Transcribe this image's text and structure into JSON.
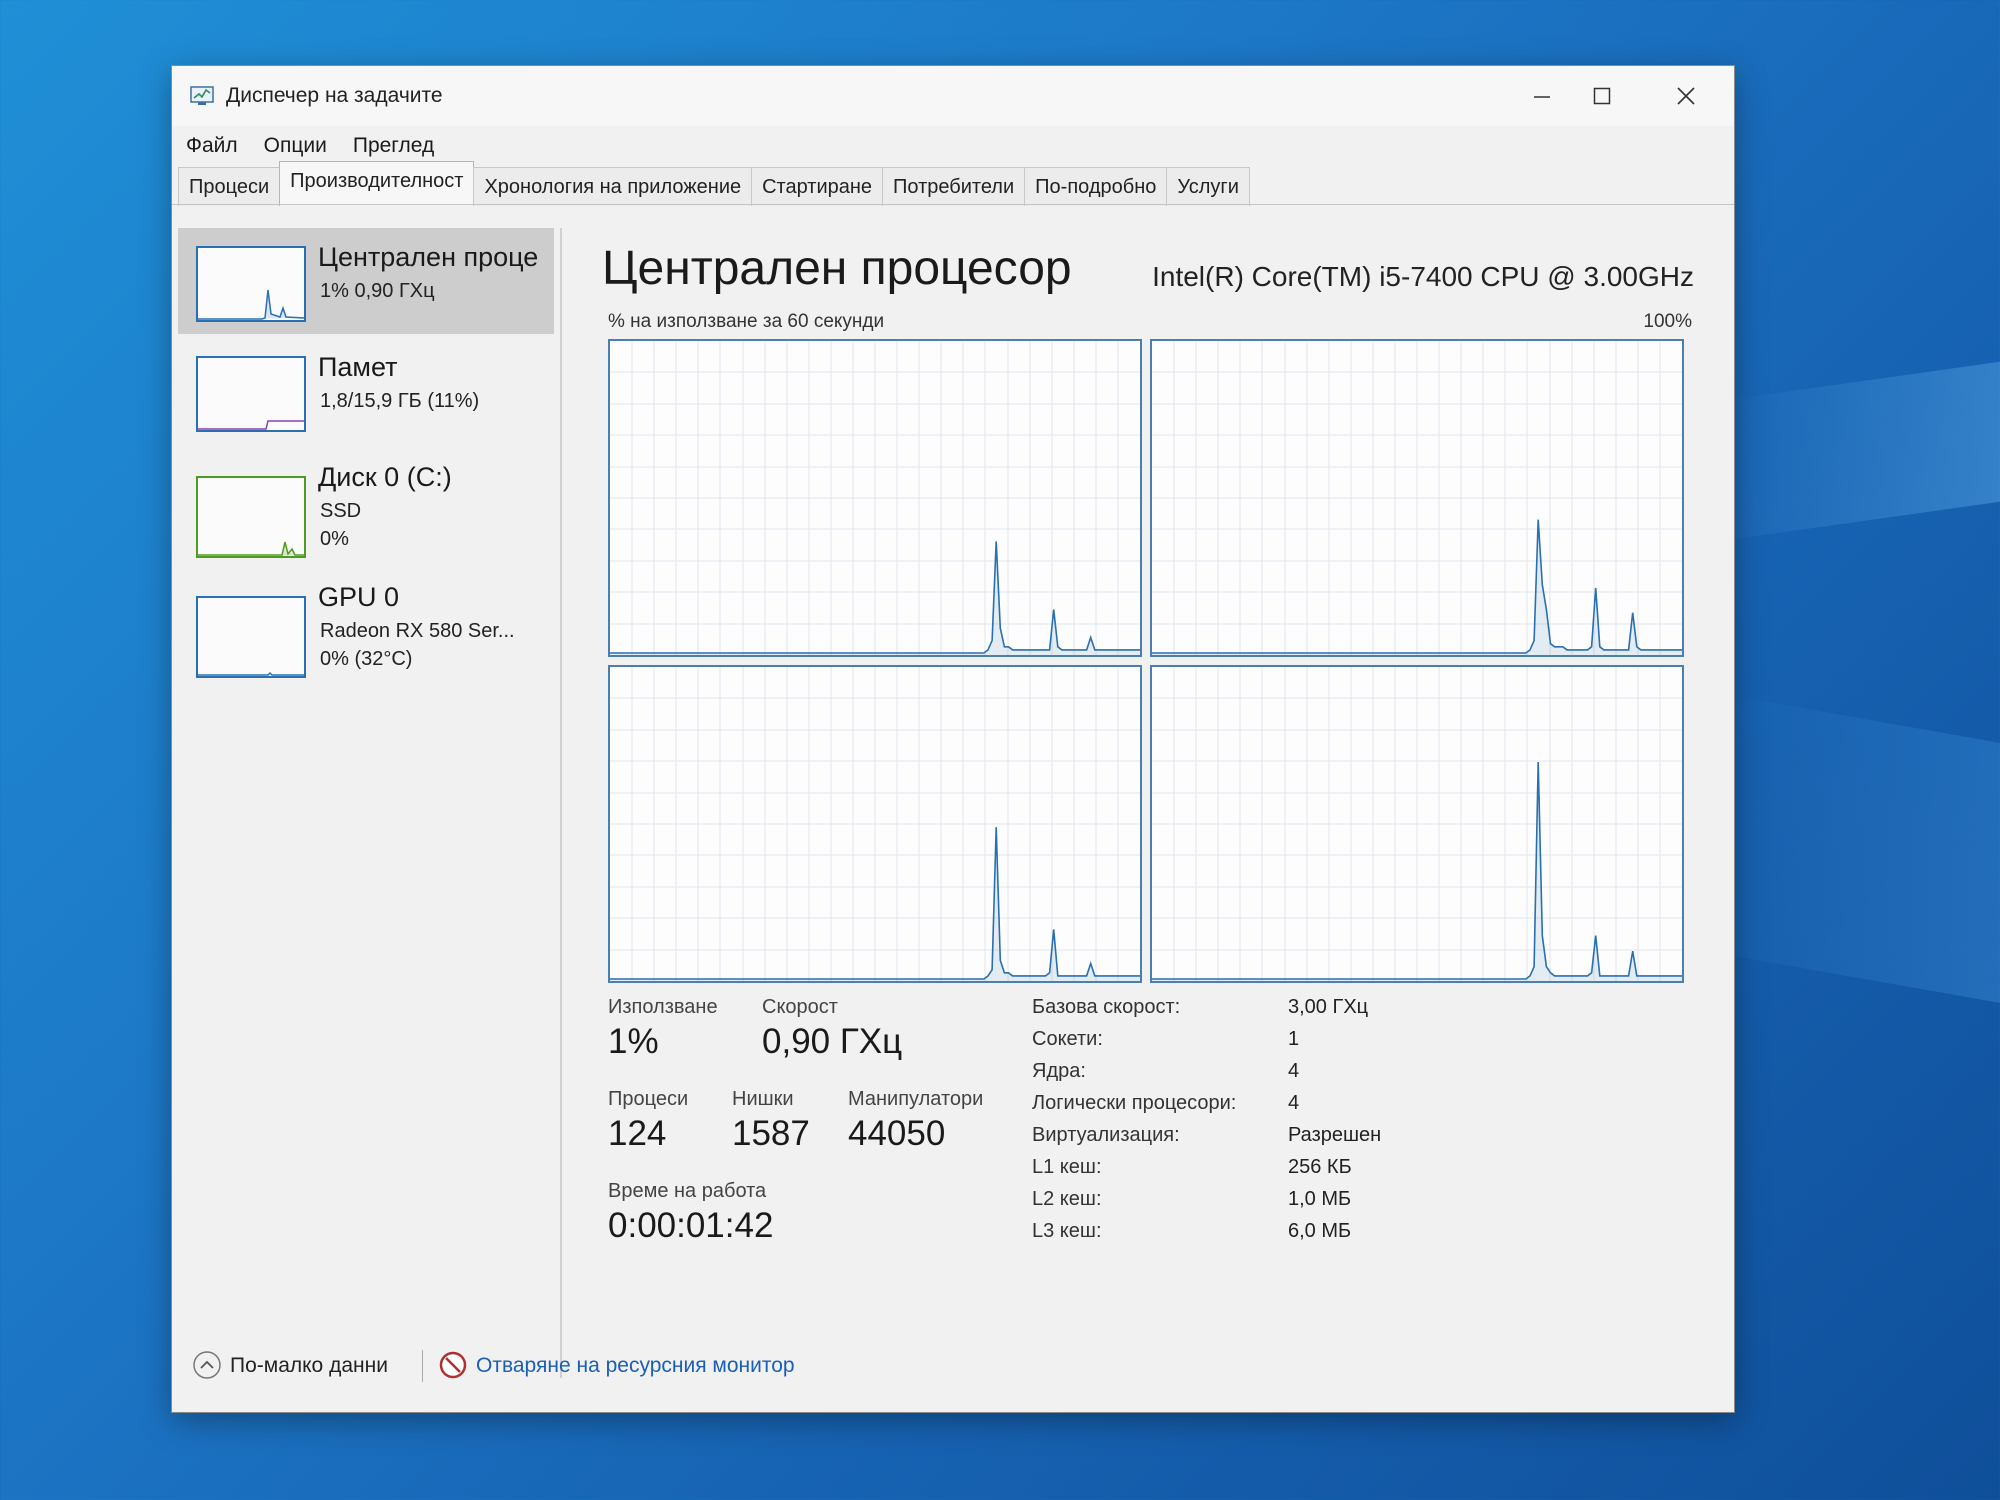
{
  "window": {
    "title": "Диспечер на задачите"
  },
  "menu": [
    "Файл",
    "Опции",
    "Преглед"
  ],
  "tabs": [
    "Процеси",
    "Производителност",
    "Хронология на приложение",
    "Стартиране",
    "Потребители",
    "По-подробно",
    "Услуги"
  ],
  "active_tab": "Производителност",
  "sidebar": {
    "cpu": {
      "name": "Централен проце",
      "line1": "1%  0,90 ГХц"
    },
    "memory": {
      "name": "Памет",
      "line1": "1,8/15,9 ГБ (11%)"
    },
    "disk": {
      "name": "Диск 0 (C:)",
      "line1": "SSD",
      "line2": "0%"
    },
    "gpu": {
      "name": "GPU 0",
      "line1": "Radeon RX 580 Ser...",
      "line2": "0%  (32°C)"
    }
  },
  "main": {
    "title": "Централен процесор",
    "model": "Intel(R) Core(TM) i5-7400 CPU @ 3.00GHz",
    "graph_label": "% на използване за 60 секунди",
    "graph_max": "100%"
  },
  "stats": {
    "usage_label": "Използване",
    "usage": "1%",
    "speed_label": "Скорост",
    "speed": "0,90 ГХц",
    "procs_label": "Процеси",
    "procs": "124",
    "threads_label": "Нишки",
    "threads": "1587",
    "handles_label": "Манипулатори",
    "handles": "44050",
    "uptime_label": "Време на работа",
    "uptime": "0:00:01:42"
  },
  "specs": [
    {
      "label": "Базова скорост:",
      "value": "3,00 ГХц"
    },
    {
      "label": "Сокети:",
      "value": "1"
    },
    {
      "label": "Ядра:",
      "value": "4"
    },
    {
      "label": "Логически процесори:",
      "value": "4"
    },
    {
      "label": "Виртуализация:",
      "value": "Разрешен"
    },
    {
      "label": "L1 кеш:",
      "value": "256 КБ"
    },
    {
      "label": "L2 кеш:",
      "value": "1,0 МБ"
    },
    {
      "label": "L3 кеш:",
      "value": "6,0 МБ"
    }
  ],
  "footer": {
    "less": "По-малко данни",
    "link": "Отваряне на ресурсния монитор"
  },
  "colors": {
    "cpu_line": "#2a6fb0",
    "disk_line": "#4f9a20",
    "link": "#1a5fb4"
  },
  "cpu_graphs": [
    [
      0,
      0,
      0,
      0,
      0,
      0,
      0,
      0,
      0,
      0,
      0,
      0,
      0,
      0,
      0,
      0,
      0,
      0,
      0,
      0,
      0,
      0,
      0,
      0,
      0,
      0,
      0,
      0,
      0,
      0,
      0,
      0,
      0,
      0,
      0,
      0,
      0,
      0,
      0,
      0,
      0,
      0,
      0,
      0,
      0,
      0,
      0,
      0,
      0,
      0,
      0,
      0,
      0,
      0,
      0,
      0,
      0,
      0,
      0,
      0,
      0,
      0,
      0,
      0,
      0,
      0,
      0,
      0,
      0,
      0,
      0,
      0,
      0,
      0,
      0,
      0,
      0,
      0,
      0,
      0,
      0,
      0,
      0,
      0,
      0,
      0,
      0,
      0,
      0,
      0,
      0,
      0,
      1,
      4,
      36,
      8,
      2,
      2,
      1,
      1,
      1,
      1,
      1,
      1,
      1,
      1,
      1,
      1,
      14,
      2,
      1,
      1,
      1,
      1,
      1,
      1,
      1,
      5,
      1,
      1,
      1,
      1,
      1,
      1,
      1,
      1,
      1,
      1,
      1,
      1
    ],
    [
      0,
      0,
      0,
      0,
      0,
      0,
      0,
      0,
      0,
      0,
      0,
      0,
      0,
      0,
      0,
      0,
      0,
      0,
      0,
      0,
      0,
      0,
      0,
      0,
      0,
      0,
      0,
      0,
      0,
      0,
      0,
      0,
      0,
      0,
      0,
      0,
      0,
      0,
      0,
      0,
      0,
      0,
      0,
      0,
      0,
      0,
      0,
      0,
      0,
      0,
      0,
      0,
      0,
      0,
      0,
      0,
      0,
      0,
      0,
      0,
      0,
      0,
      0,
      0,
      0,
      0,
      0,
      0,
      0,
      0,
      0,
      0,
      0,
      0,
      0,
      0,
      0,
      0,
      0,
      0,
      0,
      0,
      0,
      0,
      0,
      0,
      0,
      0,
      0,
      0,
      0,
      0,
      1,
      4,
      43,
      22,
      14,
      3,
      2,
      2,
      2,
      1,
      1,
      1,
      1,
      1,
      1,
      2,
      21,
      2,
      1,
      1,
      1,
      1,
      1,
      1,
      1,
      13,
      2,
      1,
      1,
      1,
      1,
      1,
      1,
      1,
      1,
      1,
      1,
      1
    ],
    [
      0,
      0,
      0,
      0,
      0,
      0,
      0,
      0,
      0,
      0,
      0,
      0,
      0,
      0,
      0,
      0,
      0,
      0,
      0,
      0,
      0,
      0,
      0,
      0,
      0,
      0,
      0,
      0,
      0,
      0,
      0,
      0,
      0,
      0,
      0,
      0,
      0,
      0,
      0,
      0,
      0,
      0,
      0,
      0,
      0,
      0,
      0,
      0,
      0,
      0,
      0,
      0,
      0,
      0,
      0,
      0,
      0,
      0,
      0,
      0,
      0,
      0,
      0,
      0,
      0,
      0,
      0,
      0,
      0,
      0,
      0,
      0,
      0,
      0,
      0,
      0,
      0,
      0,
      0,
      0,
      0,
      0,
      0,
      0,
      0,
      0,
      0,
      0,
      0,
      0,
      0,
      0,
      1,
      3,
      49,
      6,
      2,
      2,
      1,
      1,
      1,
      1,
      1,
      1,
      1,
      1,
      1,
      2,
      16,
      1,
      1,
      1,
      1,
      1,
      1,
      1,
      1,
      5,
      1,
      1,
      1,
      1,
      1,
      1,
      1,
      1,
      1,
      1,
      1,
      1
    ],
    [
      0,
      0,
      0,
      0,
      0,
      0,
      0,
      0,
      0,
      0,
      0,
      0,
      0,
      0,
      0,
      0,
      0,
      0,
      0,
      0,
      0,
      0,
      0,
      0,
      0,
      0,
      0,
      0,
      0,
      0,
      0,
      0,
      0,
      0,
      0,
      0,
      0,
      0,
      0,
      0,
      0,
      0,
      0,
      0,
      0,
      0,
      0,
      0,
      0,
      0,
      0,
      0,
      0,
      0,
      0,
      0,
      0,
      0,
      0,
      0,
      0,
      0,
      0,
      0,
      0,
      0,
      0,
      0,
      0,
      0,
      0,
      0,
      0,
      0,
      0,
      0,
      0,
      0,
      0,
      0,
      0,
      0,
      0,
      0,
      0,
      0,
      0,
      0,
      0,
      0,
      0,
      0,
      1,
      4,
      70,
      14,
      4,
      2,
      1,
      1,
      1,
      1,
      1,
      1,
      1,
      1,
      1,
      2,
      14,
      1,
      1,
      1,
      1,
      1,
      1,
      1,
      1,
      9,
      1,
      1,
      1,
      1,
      1,
      1,
      1,
      1,
      1,
      1,
      1,
      1
    ]
  ]
}
